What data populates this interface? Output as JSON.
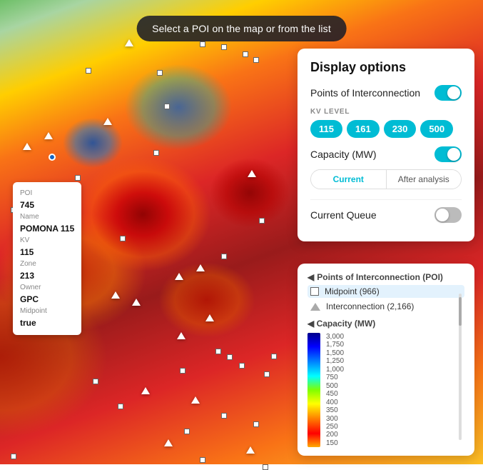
{
  "map": {
    "banner": "Select a POI on the map or from the list"
  },
  "poi_card": {
    "poi_label": "POI",
    "poi_value": "745",
    "name_label": "Name",
    "name_value": "POMONA 115",
    "kv_label": "KV",
    "kv_value": "115",
    "zone_label": "Zone",
    "zone_value": "213",
    "owner_label": "Owner",
    "owner_value": "GPC",
    "midpoint_label": "Midpoint",
    "midpoint_value": "true"
  },
  "display_options": {
    "title": "Display options",
    "points_label": "Points of Interconnection",
    "kv_section_label": "KV LEVEL",
    "kv_buttons": [
      "115",
      "161",
      "230",
      "500"
    ],
    "capacity_label": "Capacity (MW)",
    "capacity_tabs": [
      "Current",
      "After analysis"
    ],
    "current_queue_label": "Current Queue"
  },
  "legend": {
    "poi_section_title": "Points of Interconnection (POI)",
    "midpoint_label": "Midpoint (966)",
    "interconnection_label": "Interconnection (2,166)",
    "capacity_title": "Capacity (MW)",
    "capacity_levels": [
      "3,000",
      "1,750",
      "1,500",
      "1,250",
      "1,000",
      "750",
      "500",
      "450",
      "400",
      "350",
      "300",
      "250",
      "200",
      "150"
    ]
  }
}
